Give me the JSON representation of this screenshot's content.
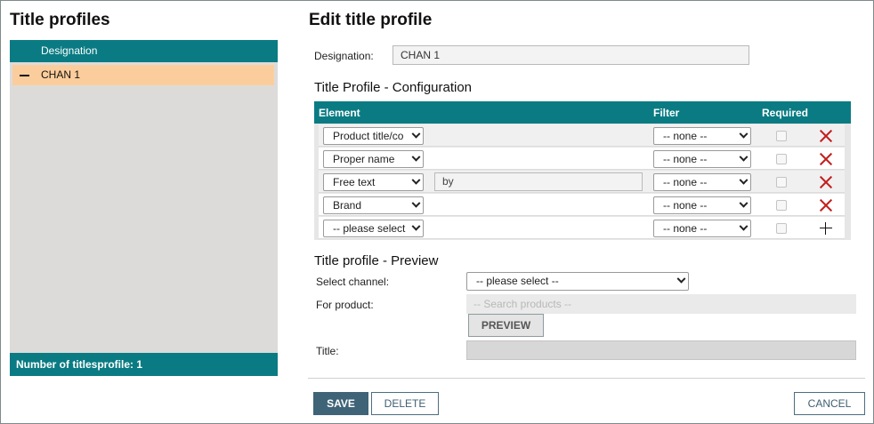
{
  "left": {
    "title": "Title profiles",
    "column_header": "Designation",
    "items": [
      {
        "label": "CHAN 1",
        "selected": true
      }
    ],
    "footer": "Number of titlesprofile: 1"
  },
  "editor": {
    "title": "Edit title profile",
    "designation_label": "Designation:",
    "designation_value": "CHAN 1",
    "config_title": "Title Profile - Configuration",
    "columns": {
      "element": "Element",
      "filter": "Filter",
      "required": "Required"
    },
    "rows": [
      {
        "element": "Product title/co",
        "extra": "",
        "filter": "-- none --",
        "action": "delete-icon"
      },
      {
        "element": "Proper name",
        "extra": "",
        "filter": "-- none --",
        "action": "delete-icon"
      },
      {
        "element": "Free text",
        "extra": "by",
        "filter": "-- none --",
        "action": "delete-icon"
      },
      {
        "element": "Brand",
        "extra": "",
        "filter": "-- none --",
        "action": "delete-icon"
      },
      {
        "element": "-- please select",
        "extra": "",
        "filter": "-- none --",
        "action": "add-icon"
      }
    ],
    "preview_title": "Title profile - Preview",
    "select_channel_label": "Select channel:",
    "select_channel_value": "-- please select --",
    "for_product_label": "For product:",
    "search_placeholder": "-- Search products --",
    "preview_button": "PREVIEW",
    "title_label": "Title:",
    "title_value": ""
  },
  "footer": {
    "save": "SAVE",
    "delete": "DELETE",
    "cancel": "CANCEL"
  },
  "colors": {
    "accent": "#0a7b83",
    "selected_row": "#fccd9c",
    "primary_button": "#3f6377",
    "delete_icon": "#c41f1f"
  }
}
